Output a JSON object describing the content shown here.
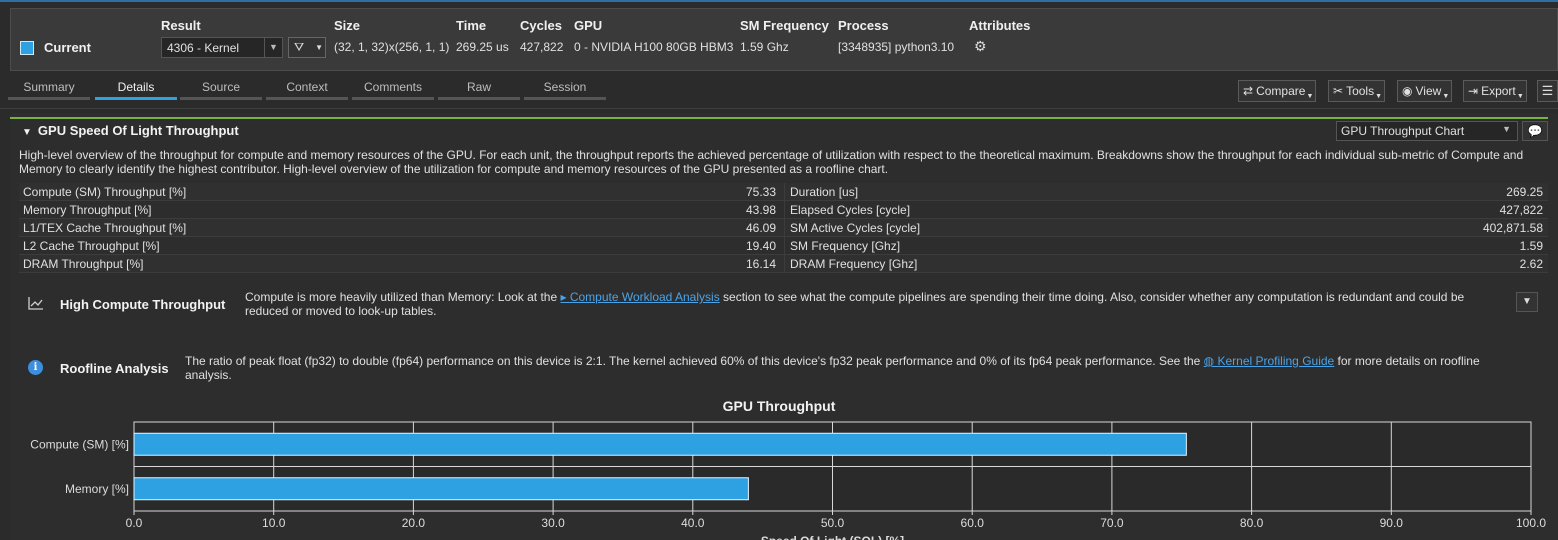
{
  "header": {
    "current_label": "Current",
    "current_color": "#2ea1e3",
    "columns": [
      {
        "label": "Result",
        "value": "4306 - Kernel"
      },
      {
        "label": "Size",
        "value": "(32, 1, 32)x(256, 1, 1)"
      },
      {
        "label": "Time",
        "value": "269.25 us"
      },
      {
        "label": "Cycles",
        "value": "427,822"
      },
      {
        "label": "GPU",
        "value": "0 - NVIDIA H100 80GB HBM3"
      },
      {
        "label": "SM Frequency",
        "value": "1.59 Ghz"
      },
      {
        "label": "Process",
        "value": "[3348935] python3.10"
      },
      {
        "label": "Attributes",
        "value": ""
      }
    ],
    "filter_icon": "filter-icon",
    "attributes_icon": "chip-icon"
  },
  "tabs": [
    {
      "label": "Summary",
      "active": false
    },
    {
      "label": "Details",
      "active": true
    },
    {
      "label": "Source",
      "active": false
    },
    {
      "label": "Context",
      "active": false
    },
    {
      "label": "Comments",
      "active": false
    },
    {
      "label": "Raw",
      "active": false
    },
    {
      "label": "Session",
      "active": false
    }
  ],
  "toolbar": {
    "compare_label": "Compare",
    "tools_label": "Tools",
    "view_label": "View",
    "export_label": "Export"
  },
  "section": {
    "title": "GPU Speed Of Light Throughput",
    "chart_select": "GPU Throughput Chart",
    "description": "High-level overview of the throughput for compute and memory resources of the GPU. For each unit, the throughput reports the achieved percentage of utilization with respect to the theoretical maximum. Breakdowns show the throughput for each individual sub-metric of Compute and Memory to clearly identify the highest contributor. High-level overview of the utilization for compute and memory resources of the GPU presented as a roofline chart.",
    "metrics": [
      {
        "left_name": "Compute (SM) Throughput [%]",
        "left_value": "75.33",
        "right_name": "Duration [us]",
        "right_value": "269.25"
      },
      {
        "left_name": "Memory Throughput [%]",
        "left_value": "43.98",
        "right_name": "Elapsed Cycles [cycle]",
        "right_value": "427,822"
      },
      {
        "left_name": "L1/TEX Cache Throughput [%]",
        "left_value": "46.09",
        "right_name": "SM Active Cycles [cycle]",
        "right_value": "402,871.58"
      },
      {
        "left_name": "L2 Cache Throughput [%]",
        "left_value": "19.40",
        "right_name": "SM Frequency [Ghz]",
        "right_value": "1.59"
      },
      {
        "left_name": "DRAM Throughput [%]",
        "left_value": "16.14",
        "right_name": "DRAM Frequency [Ghz]",
        "right_value": "2.62"
      }
    ]
  },
  "rules": {
    "compute": {
      "title": "High Compute Throughput",
      "icon": "line-chart-icon",
      "text_before": "Compute is more heavily utilized than Memory: Look at the ",
      "link": "Compute Workload Analysis",
      "text_after": " section to see what the compute pipelines are spending their time doing. Also, consider whether any computation is redundant and could be reduced or moved to look-up tables."
    },
    "roofline": {
      "title": "Roofline Analysis",
      "icon": "info-icon",
      "text_before": "The ratio of peak float (fp32) to double (fp64) performance on this device is 2:1. The kernel achieved 60% of this device's fp32 peak performance and 0% of its fp64 peak performance. See the ",
      "link": "Kernel Profiling Guide",
      "text_after": " for more details on roofline analysis."
    }
  },
  "chart_data": {
    "type": "bar",
    "orientation": "horizontal",
    "title": "GPU Throughput",
    "categories": [
      "Compute (SM) [%]",
      "Memory [%]"
    ],
    "values": [
      75.33,
      43.98
    ],
    "xlim": [
      0,
      100
    ],
    "xticks": [
      "0.0",
      "10.0",
      "20.0",
      "30.0",
      "40.0",
      "50.0",
      "60.0",
      "70.0",
      "80.0",
      "90.0",
      "100.0"
    ],
    "xlabel": "Speed Of Light (SOL) [%]",
    "grid": true,
    "bar_color": "#2ea1e3"
  }
}
